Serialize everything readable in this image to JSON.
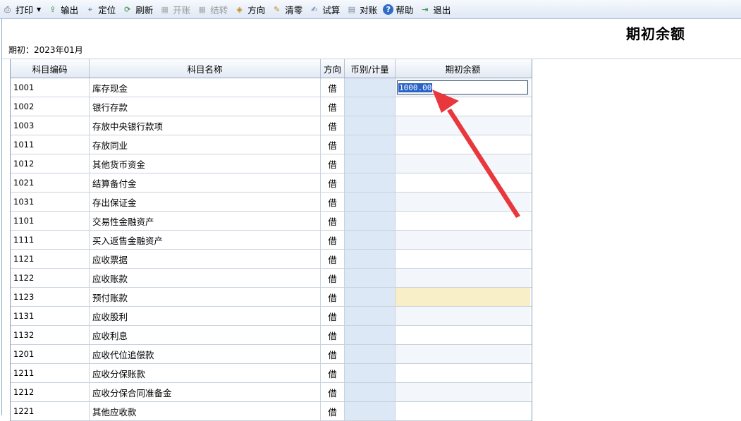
{
  "toolbar": {
    "items": [
      {
        "label": "打印",
        "icon": "printer-icon",
        "enabled": true,
        "dropdown": true
      },
      {
        "label": "输出",
        "icon": "export-icon",
        "enabled": true
      },
      {
        "label": "定位",
        "icon": "locate-icon",
        "enabled": true
      },
      {
        "label": "刷新",
        "icon": "refresh-icon",
        "enabled": true
      },
      {
        "label": "开账",
        "icon": "open-ledger-icon",
        "enabled": false
      },
      {
        "label": "结转",
        "icon": "carry-forward-icon",
        "enabled": false
      },
      {
        "label": "方向",
        "icon": "direction-icon",
        "enabled": true
      },
      {
        "label": "清零",
        "icon": "clear-icon",
        "enabled": true
      },
      {
        "label": "试算",
        "icon": "trial-balance-icon",
        "enabled": true
      },
      {
        "label": "对账",
        "icon": "reconcile-icon",
        "enabled": true
      },
      {
        "label": "帮助",
        "icon": "help-icon",
        "enabled": true
      },
      {
        "label": "退出",
        "icon": "exit-icon",
        "enabled": true
      }
    ]
  },
  "header": {
    "title": "期初余额",
    "period": "期初：2023年01月"
  },
  "table": {
    "columns": [
      "科目编码",
      "科目名称",
      "方向",
      "币别/计量",
      "期初余额"
    ],
    "rows": [
      {
        "code": "1001",
        "name": "库存现金",
        "dir": "借",
        "balance": "1000.00",
        "editing": true
      },
      {
        "code": "1002",
        "name": "银行存款",
        "dir": "借",
        "balance": ""
      },
      {
        "code": "1003",
        "name": "存放中央银行款项",
        "dir": "借",
        "balance": ""
      },
      {
        "code": "1011",
        "name": "存放同业",
        "dir": "借",
        "balance": ""
      },
      {
        "code": "1012",
        "name": "其他货币资金",
        "dir": "借",
        "balance": ""
      },
      {
        "code": "1021",
        "name": "结算备付金",
        "dir": "借",
        "balance": ""
      },
      {
        "code": "1031",
        "name": "存出保证金",
        "dir": "借",
        "balance": ""
      },
      {
        "code": "1101",
        "name": "交易性金融资产",
        "dir": "借",
        "balance": ""
      },
      {
        "code": "1111",
        "name": "买入返售金融资产",
        "dir": "借",
        "balance": ""
      },
      {
        "code": "1121",
        "name": "应收票据",
        "dir": "借",
        "balance": ""
      },
      {
        "code": "1122",
        "name": "应收账款",
        "dir": "借",
        "balance": ""
      },
      {
        "code": "1123",
        "name": "预付账款",
        "dir": "借",
        "balance": "",
        "highlight": true
      },
      {
        "code": "1131",
        "name": "应收股利",
        "dir": "借",
        "balance": ""
      },
      {
        "code": "1132",
        "name": "应收利息",
        "dir": "借",
        "balance": ""
      },
      {
        "code": "1201",
        "name": "应收代位追偿款",
        "dir": "借",
        "balance": ""
      },
      {
        "code": "1211",
        "name": "应收分保账款",
        "dir": "借",
        "balance": ""
      },
      {
        "code": "1212",
        "name": "应收分保合同准备金",
        "dir": "借",
        "balance": ""
      },
      {
        "code": "1221",
        "name": "其他应收款",
        "dir": "借",
        "balance": ""
      }
    ]
  },
  "colors": {
    "accent": "#e8383d",
    "selection": "#2a63c8",
    "currency_column": "#dde8f7",
    "highlight_cell": "#f8efc9"
  }
}
